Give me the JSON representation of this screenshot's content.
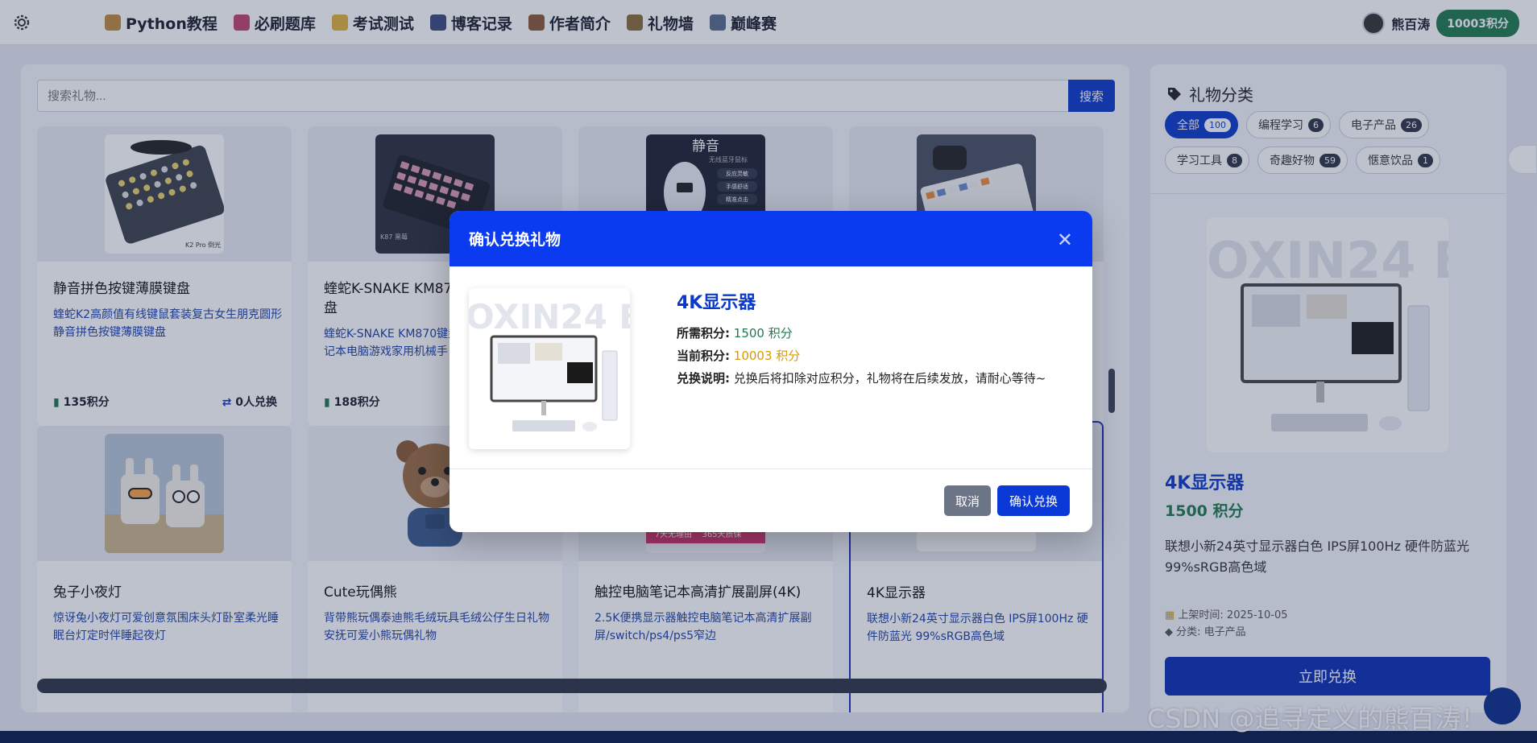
{
  "nav": {
    "items": [
      {
        "label": "Python教程",
        "icon": "scroll-icon",
        "color": "#c08a3e"
      },
      {
        "label": "必刷题库",
        "icon": "book-icon",
        "color": "#c2446b"
      },
      {
        "label": "考试测试",
        "icon": "sparkle-icon",
        "color": "#e0b23a"
      },
      {
        "label": "博客记录",
        "icon": "floppy-icon",
        "color": "#3a4a7a"
      },
      {
        "label": "作者简介",
        "icon": "bear-icon",
        "color": "#8a5a3a"
      },
      {
        "label": "礼物墙",
        "icon": "box-icon",
        "color": "#8a6a3a"
      },
      {
        "label": "巅峰赛",
        "icon": "swords-icon",
        "color": "#5a6a8a"
      }
    ],
    "user_name": "熊百涛",
    "user_points": "10003积分"
  },
  "search": {
    "placeholder": "搜索礼物...",
    "button": "搜索"
  },
  "cards": [
    {
      "title": "静音拼色按键薄膜键盘",
      "desc": "蝰蛇K2高颜值有线键鼠套装复古女生朋克圆形静音拼色按键薄膜键盘",
      "points": "135积分",
      "swaps": "0人兑换"
    },
    {
      "title": "蝰蛇K-SNAKE KM87",
      "title2": "盘",
      "desc": "蝰蛇K-SNAKE KM870键盘",
      "desc2": "记本电脑游戏家用机械手",
      "points": "188积分"
    },
    {
      "title": "兔子小夜灯",
      "desc": "惊讶兔小夜灯可爱创意氛围床头灯卧室柔光睡眠台灯定时伴睡起夜灯"
    },
    {
      "title": "Cute玩偶熊",
      "desc": "背带熊玩偶泰迪熊毛绒玩具毛绒公仔生日礼物安抚可爱小熊玩偶礼物"
    },
    {
      "title": "触控电脑笔记本高清扩展副屏(4K)",
      "desc": "2.5K便携显示器触控电脑笔记本高清扩展副屏/switch/ps4/ps5窄边",
      "badge_left": "7天无理由",
      "badge_right": "365天质保"
    },
    {
      "title": "4K显示器",
      "desc": "联想小新24英寸显示器白色 IPS屏100Hz 硬件防蓝光 99%sRGB高色域"
    }
  ],
  "product_images": {
    "mouse_title": "静音",
    "mouse_subtitle": "无线蓝牙鼠标",
    "mouse_features": [
      "反应灵敏",
      "手感舒适",
      "精准点击"
    ],
    "keyboard1_label": "K2 Pro 倒光",
    "keyboard2_label": "K87\n黑莓",
    "monitor_text": "OXIN24 BO"
  },
  "sidebar": {
    "heading": "礼物分类",
    "tags": [
      {
        "label": "全部",
        "count": "100",
        "active": true
      },
      {
        "label": "编程学习",
        "count": "6"
      },
      {
        "label": "电子产品",
        "count": "26"
      },
      {
        "label": "学习工具",
        "count": "8"
      },
      {
        "label": "奇趣好物",
        "count": "59"
      },
      {
        "label": "惬意饮品",
        "count": "1"
      }
    ],
    "title": "4K显示器",
    "price": "1500 积分",
    "desc": "联想小新24英寸显示器白色 IPS屏100Hz 硬件防蓝光99%sRGB高色域",
    "listed": "上架时间: 2025-10-05",
    "category": "分类: 电子产品",
    "button": "立即兑换"
  },
  "modal": {
    "title": "确认兑换礼物",
    "name": "4K显示器",
    "required_label": "所需积分:",
    "required_value": "1500 积分",
    "current_label": "当前积分:",
    "current_value": "10003 积分",
    "note_label": "兑换说明:",
    "note_value": "兑换后将扣除对应积分，礼物将在后续发放，请耐心等待~",
    "cancel": "取消",
    "confirm": "确认兑换"
  },
  "watermark": "CSDN @追寻定义的熊百涛！"
}
